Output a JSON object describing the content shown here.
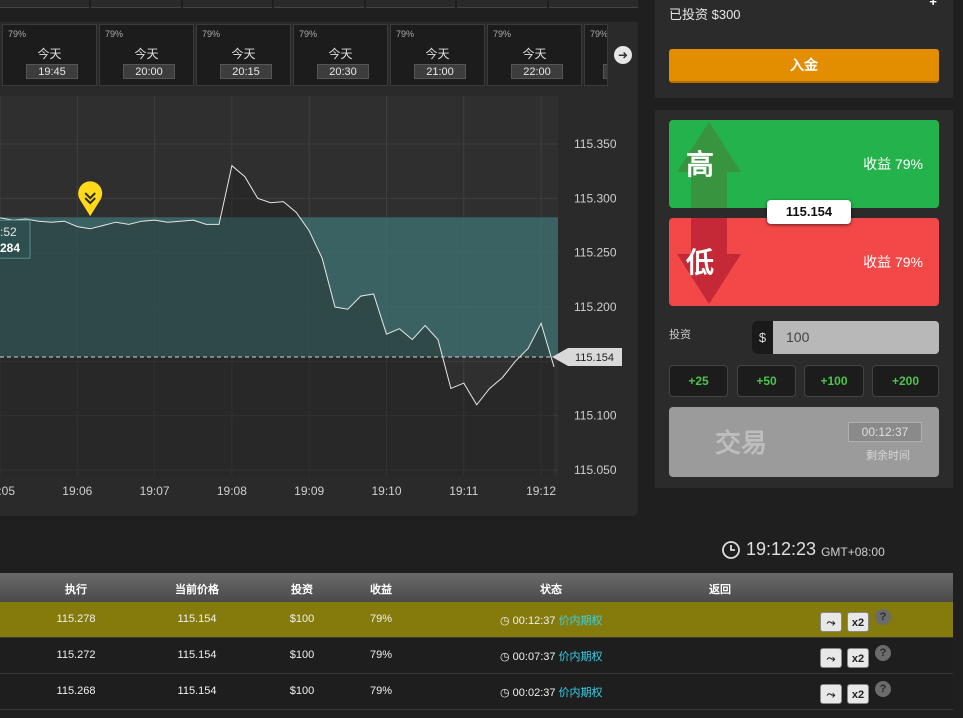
{
  "expiry_strip": {
    "tiles": [
      {
        "payout": "79%",
        "day": "今天",
        "time": "19:45"
      },
      {
        "payout": "79%",
        "day": "今天",
        "time": "20:00"
      },
      {
        "payout": "79%",
        "day": "今天",
        "time": "20:15"
      },
      {
        "payout": "79%",
        "day": "今天",
        "time": "20:30"
      },
      {
        "payout": "79%",
        "day": "今天",
        "time": "21:00"
      },
      {
        "payout": "79%",
        "day": "今天",
        "time": "22:00"
      },
      {
        "payout": "79%",
        "day": "",
        "time": ""
      }
    ],
    "next_icon": "arrow-right-icon"
  },
  "chart": {
    "y_ticks": [
      "115.350",
      "115.300",
      "115.250",
      "115.200",
      "115.150",
      "115.100",
      "115.050"
    ],
    "x_ticks": [
      "19:05",
      "19:06",
      "19:07",
      "19:08",
      "19:09",
      "19:10",
      "19:11",
      "19:12"
    ],
    "entry_label_time": ":52",
    "entry_label_price": "284",
    "current_price_tag": "115.154"
  },
  "chart_data": {
    "type": "line",
    "series": [
      {
        "x": [
          "19:05:00",
          "19:05:10",
          "19:05:20",
          "19:05:30",
          "19:05:40",
          "19:05:50",
          "19:06:00",
          "19:06:10",
          "19:06:20",
          "19:06:30",
          "19:06:40",
          "19:06:50",
          "19:07:00",
          "19:07:10",
          "19:07:20",
          "19:07:30",
          "19:07:40",
          "19:07:50",
          "19:08:00",
          "19:08:10",
          "19:08:20",
          "19:08:30",
          "19:08:40",
          "19:08:50",
          "19:09:00",
          "19:09:10",
          "19:09:20",
          "19:09:30",
          "19:09:40",
          "19:09:50",
          "19:10:00",
          "19:10:10",
          "19:10:20",
          "19:10:30",
          "19:10:40",
          "19:10:50",
          "19:11:00",
          "19:11:10",
          "19:11:20",
          "19:11:30",
          "19:11:40",
          "19:11:50",
          "19:12:00",
          "19:12:10"
        ],
        "y": [
          115.282,
          115.28,
          115.281,
          115.279,
          115.278,
          115.279,
          115.274,
          115.272,
          115.275,
          115.278,
          115.276,
          115.279,
          115.28,
          115.278,
          115.279,
          115.28,
          115.276,
          115.276,
          115.33,
          115.32,
          115.3,
          115.296,
          115.297,
          115.287,
          115.27,
          115.245,
          115.2,
          115.198,
          115.21,
          115.212,
          115.175,
          115.18,
          115.17,
          115.183,
          115.17,
          115.125,
          115.13,
          115.11,
          115.125,
          115.135,
          115.15,
          115.162,
          115.185,
          115.145
        ]
      }
    ],
    "entry_price": 115.278,
    "current_price": 115.154,
    "ylim": [
      115.05,
      115.35
    ],
    "grid": true
  },
  "account": {
    "invested_label": "已投资 $300",
    "plus_icon": "plus-icon",
    "deposit_label": "入金"
  },
  "trade": {
    "high_label": "高",
    "high_payout": "收益 79%",
    "low_label": "低",
    "low_payout": "收益 79%",
    "price": "115.154",
    "invest_label": "投资",
    "currency": "$",
    "amount": "100",
    "increments": [
      "+25",
      "+50",
      "+100",
      "+200"
    ],
    "trade_label": "交易",
    "countdown": "00:12:37",
    "remaining_label": "剩余时间",
    "colors": {
      "high": "#23b24b",
      "low": "#f24848",
      "deposit": "#e38e00"
    }
  },
  "clock": {
    "icon": "clock-icon",
    "time": "19:12:23",
    "timezone": "GMT+08:00"
  },
  "positions": {
    "headers": [
      "执行",
      "当前价格",
      "投资",
      "收益",
      "状态",
      "返回"
    ],
    "rows": [
      {
        "entry": "115.278",
        "current": "115.154",
        "invest": "$100",
        "payout": "79%",
        "time": "00:12:37",
        "status": "价内期权",
        "actions": [
          "share-icon",
          "x2"
        ]
      },
      {
        "entry": "115.272",
        "current": "115.154",
        "invest": "$100",
        "payout": "79%",
        "time": "00:07:37",
        "status": "价内期权",
        "actions": [
          "share-icon",
          "x2"
        ]
      },
      {
        "entry": "115.268",
        "current": "115.154",
        "invest": "$100",
        "payout": "79%",
        "time": "00:02:37",
        "status": "价内期权",
        "actions": [
          "share-icon",
          "x2"
        ]
      }
    ]
  }
}
